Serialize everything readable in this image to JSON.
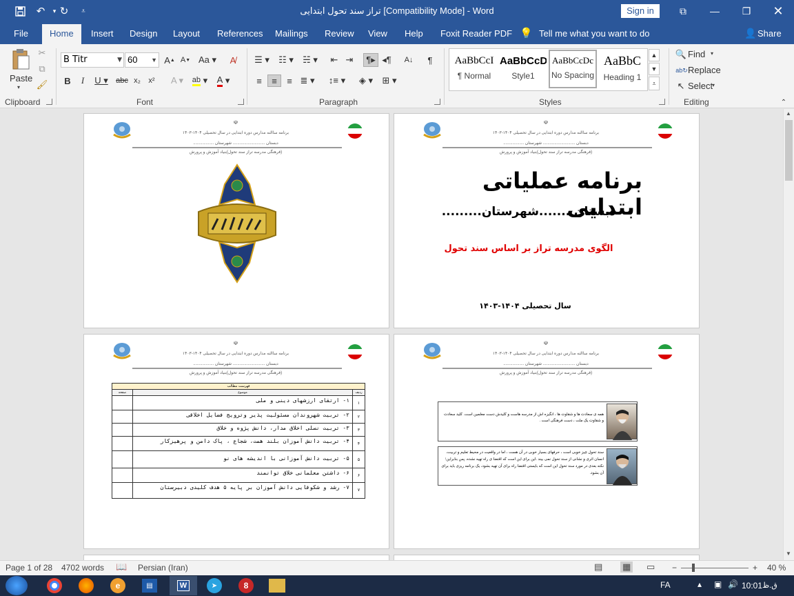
{
  "window": {
    "title": "تراز سند تحول ابتدایی [Compatibility Mode] - Word",
    "signin": "Sign in"
  },
  "tabs": [
    "File",
    "Home",
    "Insert",
    "Design",
    "Layout",
    "References",
    "Mailings",
    "Review",
    "View",
    "Help",
    "Foxit Reader PDF"
  ],
  "tell_me": "Tell me what you want to do",
  "share": "Share",
  "ribbon": {
    "clipboard": {
      "label": "Clipboard",
      "paste": "Paste"
    },
    "font": {
      "label": "Font",
      "name": "B Titr",
      "size": "60"
    },
    "paragraph": {
      "label": "Paragraph"
    },
    "styles": {
      "label": "Styles",
      "items": [
        {
          "preview": "AaBbCcI",
          "name": "¶ Normal"
        },
        {
          "preview": "AaBbCcD",
          "name": "Style1"
        },
        {
          "preview": "AaBbCcDc",
          "name": "No Spacing"
        },
        {
          "preview": "AaBbC",
          "name": "Heading 1"
        }
      ]
    },
    "editing": {
      "label": "Editing",
      "find": "Find",
      "replace": "Replace",
      "select": "Select"
    }
  },
  "header": {
    "line1": "برنامه ساالنه مدارس دوره ابتدایی در سال تحصیلی ۱۴۰۴-۱۴۰۳",
    "line2": "دبستان ............................ شهرستان ..................",
    "line3": "(فرهنگی مدرسه تراز سند تحول)بنیاد آموزش و پرورش"
  },
  "cover": {
    "title": "برنامه عملیاتی ابتدایی",
    "subtitle": "دبستان .......شهرستان.........",
    "model": "الگوی مدرسه تراز بر اساس سند تحول",
    "year": "سال تحصیلی ۱۴۰۴-۱۴۰۳"
  },
  "toc": {
    "title": "فهرست مطالب",
    "col_row": "ردیف",
    "col_subject": "موضوع",
    "col_page": "صفحه",
    "rows": [
      {
        "num": "۱",
        "text": "۱- ارتقای ارزشهای دینی و ملی"
      },
      {
        "num": "۲",
        "text": "۲- تربیت شهروندان مسئولیت پذیر وترویج فضایل اخلاقی"
      },
      {
        "num": "۳",
        "text": "۳- تربیت نسلی اخلاق مدار، دانش پژوه و خلاق"
      },
      {
        "num": "۴",
        "text": "۴- تربیت دانش آموزان بلند همت، شجاع ، پاک دامن و پرهیزکار"
      },
      {
        "num": "۵",
        "text": "۵- تربیت دانش آموزانی با اندیشه های نو"
      },
      {
        "num": "۶",
        "text": "۶- داشتن معلمانی خلاق توانمند"
      },
      {
        "num": "۷",
        "text": "۷- رشد و شکوفایی دانش آموزان بر پایه ۵ هدف کلیدی دبیرستان"
      }
    ]
  },
  "quotes": [
    "همه ی سعادت ها و شقاوت ها ، انگیزه اش از مدرسه هاست و کلیدش دست معلمین است. کلید سعادت و شقاوت یک ملت ، دست فرهنگی است .",
    "سند تحول چیز خوبی است ، حرفهای بسیار خوبی در آن هست ، اما در واقعیت در محیط تعلیم و تربیت، انسان اثری و نشانی از سند تحول نمی بیند .این برای این است که اقتضا ی راه تهیه نشده. پس بنابراین؛ نکته بعدی در مورد سند تحول این است که بایستی اقتضا راه برای آن تهیه بشود، یک برنامه ریزی باید برای آن بشود."
  ],
  "status": {
    "page": "Page 1 of 28",
    "words": "4702 words",
    "language": "Persian (Iran)",
    "zoom": "40 %"
  },
  "taskbar": {
    "lang": "FA",
    "time": "10:01",
    "ampm": "ق.ظ"
  }
}
